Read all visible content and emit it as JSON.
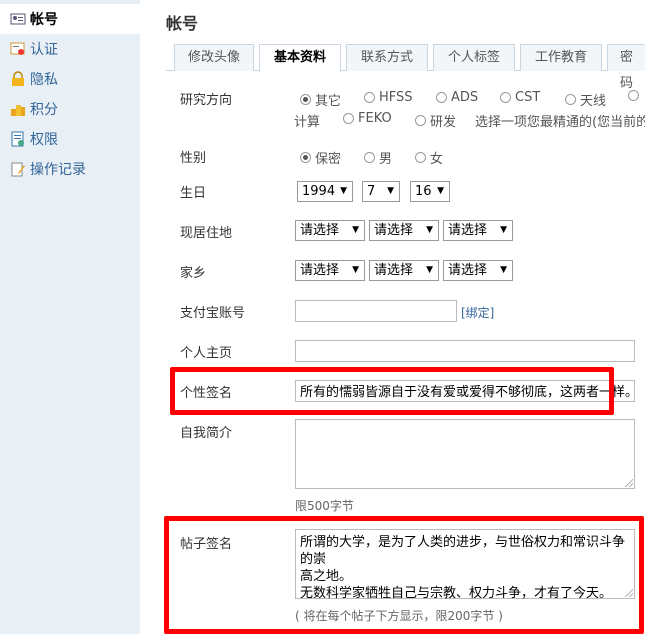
{
  "sidebar": {
    "items": [
      {
        "label": "帐号",
        "icon": "account-card-icon"
      },
      {
        "label": "认证",
        "icon": "certificate-icon"
      },
      {
        "label": "隐私",
        "icon": "lock-icon"
      },
      {
        "label": "积分",
        "icon": "coins-icon"
      },
      {
        "label": "权限",
        "icon": "permission-doc-icon"
      },
      {
        "label": "操作记录",
        "icon": "edit-log-icon"
      }
    ]
  },
  "header": {
    "title": "帐号"
  },
  "tabs": [
    {
      "label": "修改头像"
    },
    {
      "label": "基本资料"
    },
    {
      "label": "联系方式"
    },
    {
      "label": "个人标签"
    },
    {
      "label": "工作教育"
    },
    {
      "label": "密码"
    }
  ],
  "form": {
    "research": {
      "label": "研究方向",
      "options": [
        "其它",
        "HFSS",
        "ADS",
        "CST",
        "天线",
        "计算",
        "FEKO",
        "研发"
      ],
      "selected": "其它",
      "hint": "选择一项您最精通的(您当前的研"
    },
    "gender": {
      "label": "性别",
      "options": [
        "保密",
        "男",
        "女"
      ],
      "selected": "保密"
    },
    "birthday": {
      "label": "生日",
      "year": "1994",
      "month": "7",
      "day": "16"
    },
    "residence": {
      "label": "现居住地",
      "province": "请选择",
      "city": "请选择",
      "district": "请选择"
    },
    "hometown": {
      "label": "家乡",
      "province": "请选择",
      "city": "请选择",
      "district": "请选择"
    },
    "alipay": {
      "label": "支付宝账号",
      "value": "",
      "bind_link": "[绑定]"
    },
    "homepage": {
      "label": "个人主页",
      "value": ""
    },
    "signature": {
      "label": "个性签名",
      "value": "所有的懦弱皆源自于没有爱或爱得不够彻底，这两者一样。"
    },
    "bio": {
      "label": "自我简介",
      "value": "",
      "hint": "限500字节"
    },
    "post_signature": {
      "label": "帖子签名",
      "line1": "所谓的大学，是为了人类的进步，与世俗权力和常识斗争的崇",
      "line2": "高之地。",
      "line3": "无数科学家牺牲自己与宗教、权力斗争，才有了今天。",
      "hint": "( 将在每个帖子下方显示，限200字节 )"
    }
  },
  "colors": {
    "sidebar_bg": "#e8eff5",
    "link": "#336699",
    "highlight": "#ff0000"
  }
}
